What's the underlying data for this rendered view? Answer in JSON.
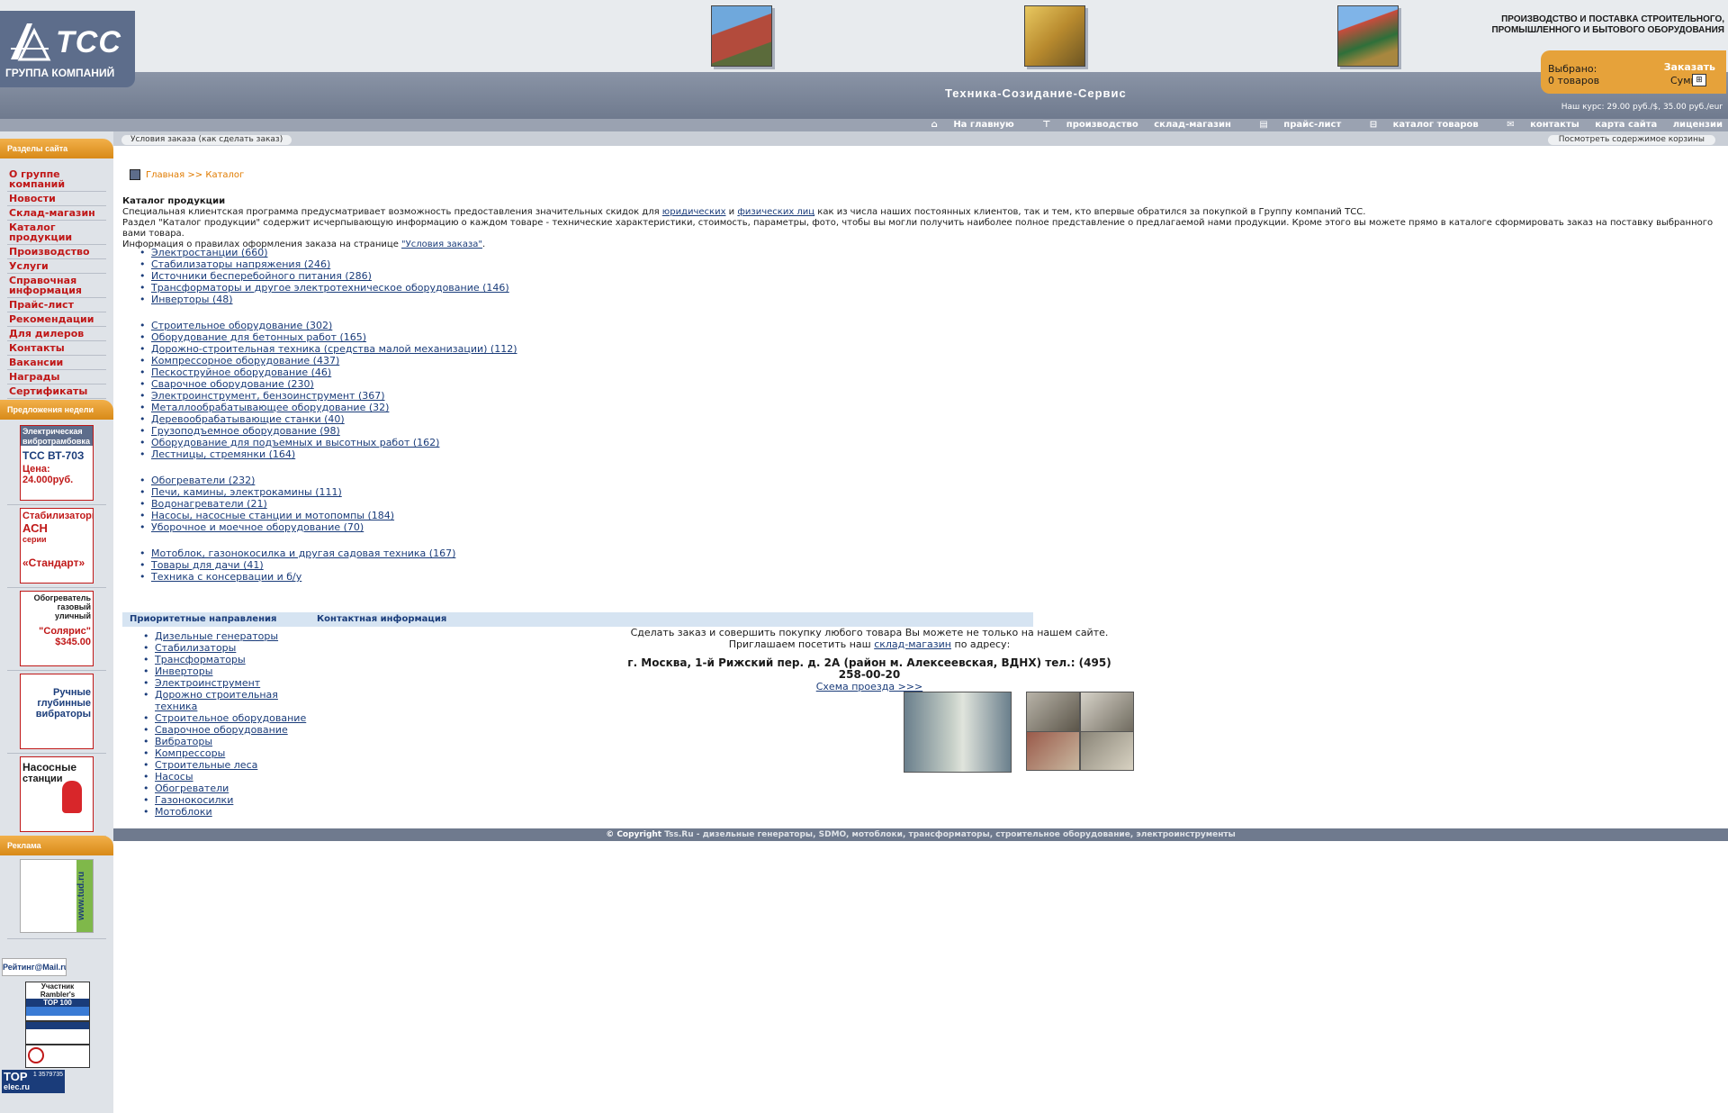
{
  "header": {
    "logo_text": "ТСС",
    "logo_subtitle": "ГРУППА КОМПАНИЙ",
    "tagline_1": "ПРОИЗВОДСТВО И ПОСТАВКА СТРОИТЕЛЬНОГО,",
    "tagline_2": "ПРОМЫШЛЕННОГО И БЫТОВОГО ОБОРУДОВАНИЯ",
    "slogan": "Техника-Созидание-Сервис",
    "cart": {
      "selected_label": "Выбрано:",
      "items": "0 товаров",
      "sum_label": "Сумма:",
      "order_button": "Заказать"
    },
    "rate": "Наш курс: 29.00 руб./$, 35.00 руб./eur",
    "nav": [
      "На главную",
      "производство",
      "склад-магазин",
      "прайс-лист",
      "каталог товаров",
      "контакты",
      "карта сайта",
      "лицензии"
    ],
    "subtab_left": "Условия заказа (как сделать заказ)",
    "subtab_right": "Посмотреть содержимое корзины"
  },
  "sidebar": {
    "sections_title": "Разделы сайта",
    "menu": [
      "О группе компаний",
      "Новости",
      "Склад-магазин",
      "Каталог продукции",
      "Производство",
      "Услуги",
      "Справочная информация",
      "Прайс-лист",
      "Рекомендации",
      "Для дилеров",
      "Контакты",
      "Вакансии",
      "Награды",
      "Сертификаты"
    ],
    "offers_title": "Предложения недели",
    "promos": [
      {
        "l1": "Электрическая",
        "l2": "вибротрамбовка",
        "l3": "ТСС ВТ-70З",
        "l4": "Цена:",
        "l5": "24.000руб."
      },
      {
        "l1": "Стабилизаторы",
        "l2": "АСН",
        "l3": "серии",
        "l4": "«Стандарт»"
      },
      {
        "l1": "Обогреватель",
        "l2": "газовый",
        "l3": "уличный",
        "l4": "\"Солярис\"",
        "l5": "$345.00"
      },
      {
        "l1": "Ручные",
        "l2": "глубинные",
        "l3": "вибраторы"
      },
      {
        "l1": "Насосные",
        "l2": "станции"
      }
    ],
    "ads_title": "Реклама",
    "ad_text": "www.tud.ru",
    "rating_alt": "Рейтинг@Mail.ru",
    "rambler_1": "Участник",
    "rambler_2": "Rambler's",
    "rambler_3": "TOP 100",
    "top_text": "TOP",
    "top_sub": "elec.ru",
    "top_nums": "1 3579735"
  },
  "breadcrumb": {
    "home": "Главная",
    "sep": ">>",
    "current": "Каталог"
  },
  "intro": {
    "title": "Каталог продукции",
    "p1a": "Специальная клиентская программа предусматривает возможность предоставления значительных скидок для ",
    "p1_link1": "юридических",
    "p1b": " и ",
    "p1_link2": "физических лиц",
    "p1c": " как из числа наших постоянных клиентов, так и тем, кто впервые обратился за покупкой в Группу компаний ТСС.",
    "p2": "Раздел \"Каталог продукции\" содержит исчерпывающую информацию о каждом товаре - технические характеристики, стоимость, параметры, фото, чтобы вы могли получить наиболее полное представление о предлагаемой нами продукции. Кроме этого вы можете прямо в каталоге сформировать заказ на поставку выбранного вами товара.",
    "p3a": "Информация о правилах оформления заказа на странице ",
    "p3_link": "\"Условия заказа\"",
    "p3b": "."
  },
  "catalog": {
    "group1": [
      "Электростанции (660)",
      "Стабилизаторы напряжения (246)",
      "Источники бесперебойного питания (286)",
      "Трансформаторы и другое электротехническое оборудование (146)",
      "Инверторы (48)"
    ],
    "group2": [
      "Строительное оборудование (302)",
      "Оборудование для бетонных работ (165)",
      "Дорожно-строительная техника (средства малой механизации) (112)",
      "Компрессорное оборудование (437)",
      "Пескоструйное оборудование (46)",
      "Сварочное оборудование (230)",
      "Электроинструмент, бензоинструмент (367)",
      "Металлообрабатывающее оборудование (32)",
      "Деревообрабатывающие станки (40)",
      "Грузоподъемное оборудование (98)",
      "Оборудование для подъемных и высотных работ (162)",
      "Лестницы, стремянки (164)"
    ],
    "group3": [
      "Обогреватели (232)",
      "Печи, камины, электрокамины (111)",
      "Водонагреватели (21)",
      "Насосы, насосные станции и мотопомпы (184)",
      "Уборочное и моечное оборудование (70)"
    ],
    "group4": [
      "Мотоблок, газонокосилка и другая садовая техника (167)",
      "Товары для дачи (41)",
      "Техника с консервации и б/у"
    ]
  },
  "priority": {
    "title": "Приоритетные направления",
    "items": [
      "Дизельные генераторы",
      "Стабилизаторы",
      "Трансформаторы",
      "Инверторы",
      "Электроинструмент",
      "Дорожно строительная техника",
      "Строительное оборудование",
      "Сварочное оборудование",
      "Вибраторы",
      "Компрессоры",
      "Строительные леса",
      "Насосы",
      "Обогреватели",
      "Газонокосилки",
      "Мотоблоки"
    ]
  },
  "contact": {
    "title": "Контактная информация",
    "line1": "Сделать заказ и совершить покупку любого товара Вы можете не только на нашем сайте.",
    "line2a": "Приглашаем посетить наш ",
    "line2_link": "склад-магазин",
    "line2b": " по адресу:",
    "address": "г. Москва, 1-й Рижский пер. д. 2А (район м. Алексеевская, ВДНХ) тел.: (495) 258-00-20",
    "map_link": "Схема проезда >>>"
  },
  "footer": {
    "copyright": "© Copyright",
    "site": "Tss.Ru",
    "text": " - дизельные генераторы, SDMO, мотоблоки, трансформаторы, строительное оборудование, электроинструменты"
  },
  "colors": {
    "accent": "#e6a23a",
    "menu_red": "#c01818",
    "link": "#1a3c7a",
    "band": "#6f7a8e"
  }
}
